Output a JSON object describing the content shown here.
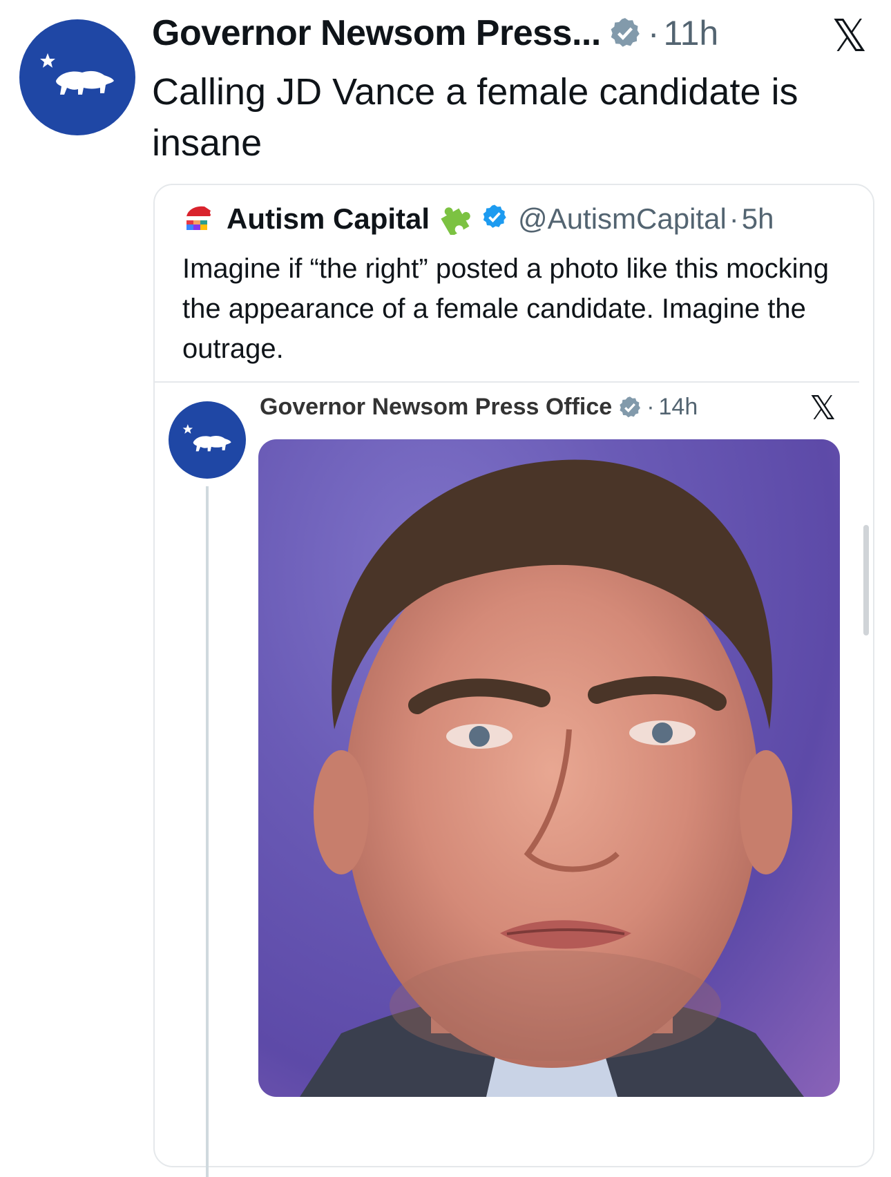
{
  "post": {
    "author": "Governor Newsom Press...",
    "separator": "·",
    "time": "11h",
    "text": "Calling JD Vance a female candidate is insane",
    "avatar_icon": "california-bear-icon",
    "verified_icon": "verified-badge-grey-icon",
    "platform_icon": "x-logo-icon"
  },
  "quote": {
    "author": "Autism Capital",
    "handle": "@AutismCapital",
    "separator": "·",
    "time": "5h",
    "text": "Imagine if “the right” posted a photo like this mocking the appearance of a female candidate. Imagine the outrage.",
    "avatar_icon": "puzzle-santa-hat-icon",
    "name_emoji": "puzzle-piece-icon",
    "verified_icon": "verified-badge-blue-icon"
  },
  "inner_post": {
    "author": "Governor Newsom Press Office",
    "separator": "·",
    "time": "14h",
    "avatar_icon": "california-bear-icon",
    "verified_icon": "verified-badge-grey-icon",
    "platform_icon": "x-logo-icon",
    "image_icon": "portrait-photo"
  },
  "colors": {
    "avatar_blue": "#1f47a5",
    "verified_blue": "#1d9bf0",
    "verified_grey": "#829aab",
    "meta_grey": "#536471"
  }
}
